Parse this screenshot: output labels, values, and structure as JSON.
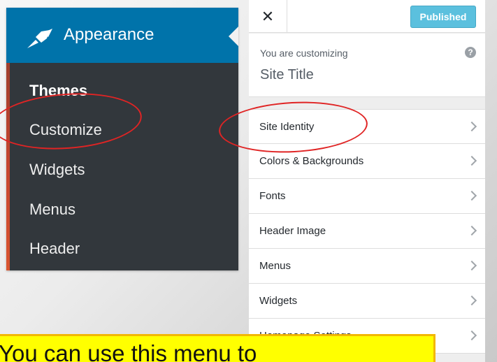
{
  "admin_menu": {
    "section_label": "Appearance",
    "items": [
      {
        "label": "Themes",
        "current": true
      },
      {
        "label": "Customize",
        "current": false
      },
      {
        "label": "Widgets",
        "current": false
      },
      {
        "label": "Menus",
        "current": false
      },
      {
        "label": "Header",
        "current": false
      }
    ]
  },
  "customizer": {
    "close_icon": "close-icon",
    "publish_label": "Published",
    "customizing_label": "You are customizing",
    "site_title": "Site Title",
    "help_icon": "?",
    "sections": [
      {
        "label": "Site Identity"
      },
      {
        "label": "Colors & Backgrounds"
      },
      {
        "label": "Fonts"
      },
      {
        "label": "Header Image"
      },
      {
        "label": "Menus"
      },
      {
        "label": "Widgets"
      },
      {
        "label": "Homepage Settings"
      }
    ]
  },
  "callout": {
    "text": "You can use this menu to"
  },
  "colors": {
    "wp_blue": "#0073aa",
    "wp_dark": "#32373c",
    "annotation_red": "#e02424",
    "callout_yellow": "#ffff00"
  }
}
